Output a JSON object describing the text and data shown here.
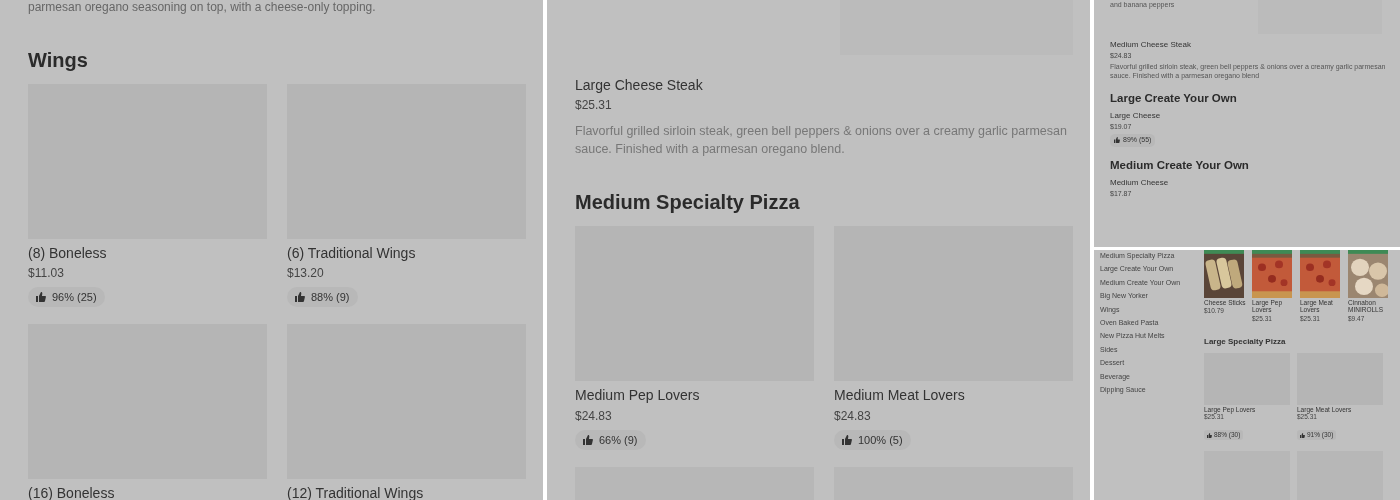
{
  "panels": [
    {
      "kind": "menu",
      "blocks": [
        {
          "kind": "text",
          "text": "parmesan oregano seasoning on top, with a cheese-only topping."
        },
        {
          "kind": "heading",
          "text": "Wings"
        },
        {
          "kind": "grid",
          "items": [
            {
              "kind": "product",
              "name": "(8) Boneless",
              "price": "$11.03",
              "rating": "96% (25)"
            },
            {
              "kind": "product",
              "name": "(6) Traditional Wings",
              "price": "$13.20",
              "rating": "88% (9)"
            },
            {
              "kind": "product",
              "name": "(16) Boneless"
            },
            {
              "kind": "product",
              "name": "(12) Traditional Wings"
            }
          ]
        }
      ]
    },
    {
      "kind": "menu",
      "blocks": [
        {
          "kind": "image_strip",
          "items": [
            {
              "kind": "blank"
            },
            {
              "kind": "placeholder"
            }
          ]
        },
        {
          "kind": "item",
          "name": "Large Cheese Steak",
          "price": "$25.31",
          "description": "Flavorful grilled sirloin steak, green bell peppers & onions over a creamy garlic parmesan sauce. Finished with a parmesan oregano blend."
        },
        {
          "kind": "heading",
          "text": "Medium Specialty Pizza"
        },
        {
          "kind": "grid",
          "items": [
            {
              "kind": "product",
              "name": "Medium Pep Lovers",
              "price": "$24.83",
              "rating": "66% (9)"
            },
            {
              "kind": "product",
              "name": "Medium Meat Lovers",
              "price": "$24.83",
              "rating": "100% (5)"
            },
            {
              "kind": "placeholder"
            },
            {
              "kind": "placeholder"
            }
          ]
        }
      ]
    },
    {
      "kind": "compact_menu",
      "blocks": [
        {
          "kind": "image_strip",
          "items": [
            {
              "kind": "text",
              "text": "and banana peppers"
            },
            {
              "kind": "placeholder"
            }
          ]
        },
        {
          "kind": "item",
          "name": "Medium Cheese Steak",
          "price": "$24.83",
          "description": "Flavorful grilled sirloin steak, green bell peppers & onions over a creamy garlic parmesan sauce. Finished with a parmesan oregano blend"
        },
        {
          "kind": "heading",
          "text": "Large Create Your Own"
        },
        {
          "kind": "item",
          "name": "Large Cheese",
          "price": "$19.07",
          "rating": "89% (55)"
        },
        {
          "kind": "heading",
          "text": "Medium Create Your Own"
        },
        {
          "kind": "item",
          "name": "Medium Cheese",
          "price": "$17.87"
        }
      ]
    },
    {
      "kind": "store",
      "categories": [
        "Medium Specialty Pizza",
        "Large Create Your Own",
        "Medium Create Your Own",
        "Big New Yorker",
        "Wings",
        "Oven Baked Pasta",
        "New Pizza Hut Melts",
        "Sides",
        "Dessert",
        "Beverage",
        "Dipping Sauce"
      ],
      "featured": [
        {
          "name": "Cheese Sticks",
          "price": "$10.79",
          "kind": "sticks"
        },
        {
          "name": "Large Pep Lovers",
          "price": "$25.31",
          "kind": "pizza"
        },
        {
          "name": "Large Meat Lovers",
          "price": "$25.31",
          "kind": "pizza"
        },
        {
          "name": "Cinnabon MINIROLLS",
          "price": "$9.47",
          "kind": "rolls"
        }
      ],
      "heading": "Large Specialty Pizza",
      "grid": [
        {
          "kind": "product",
          "name": "Large Pep Lovers",
          "price": "$25.31",
          "rating": "88% (30)"
        },
        {
          "kind": "product",
          "name": "Large Meat Lovers",
          "price": "$25.31",
          "rating": "91% (30)"
        },
        {
          "kind": "placeholder"
        },
        {
          "kind": "placeholder"
        }
      ]
    }
  ]
}
